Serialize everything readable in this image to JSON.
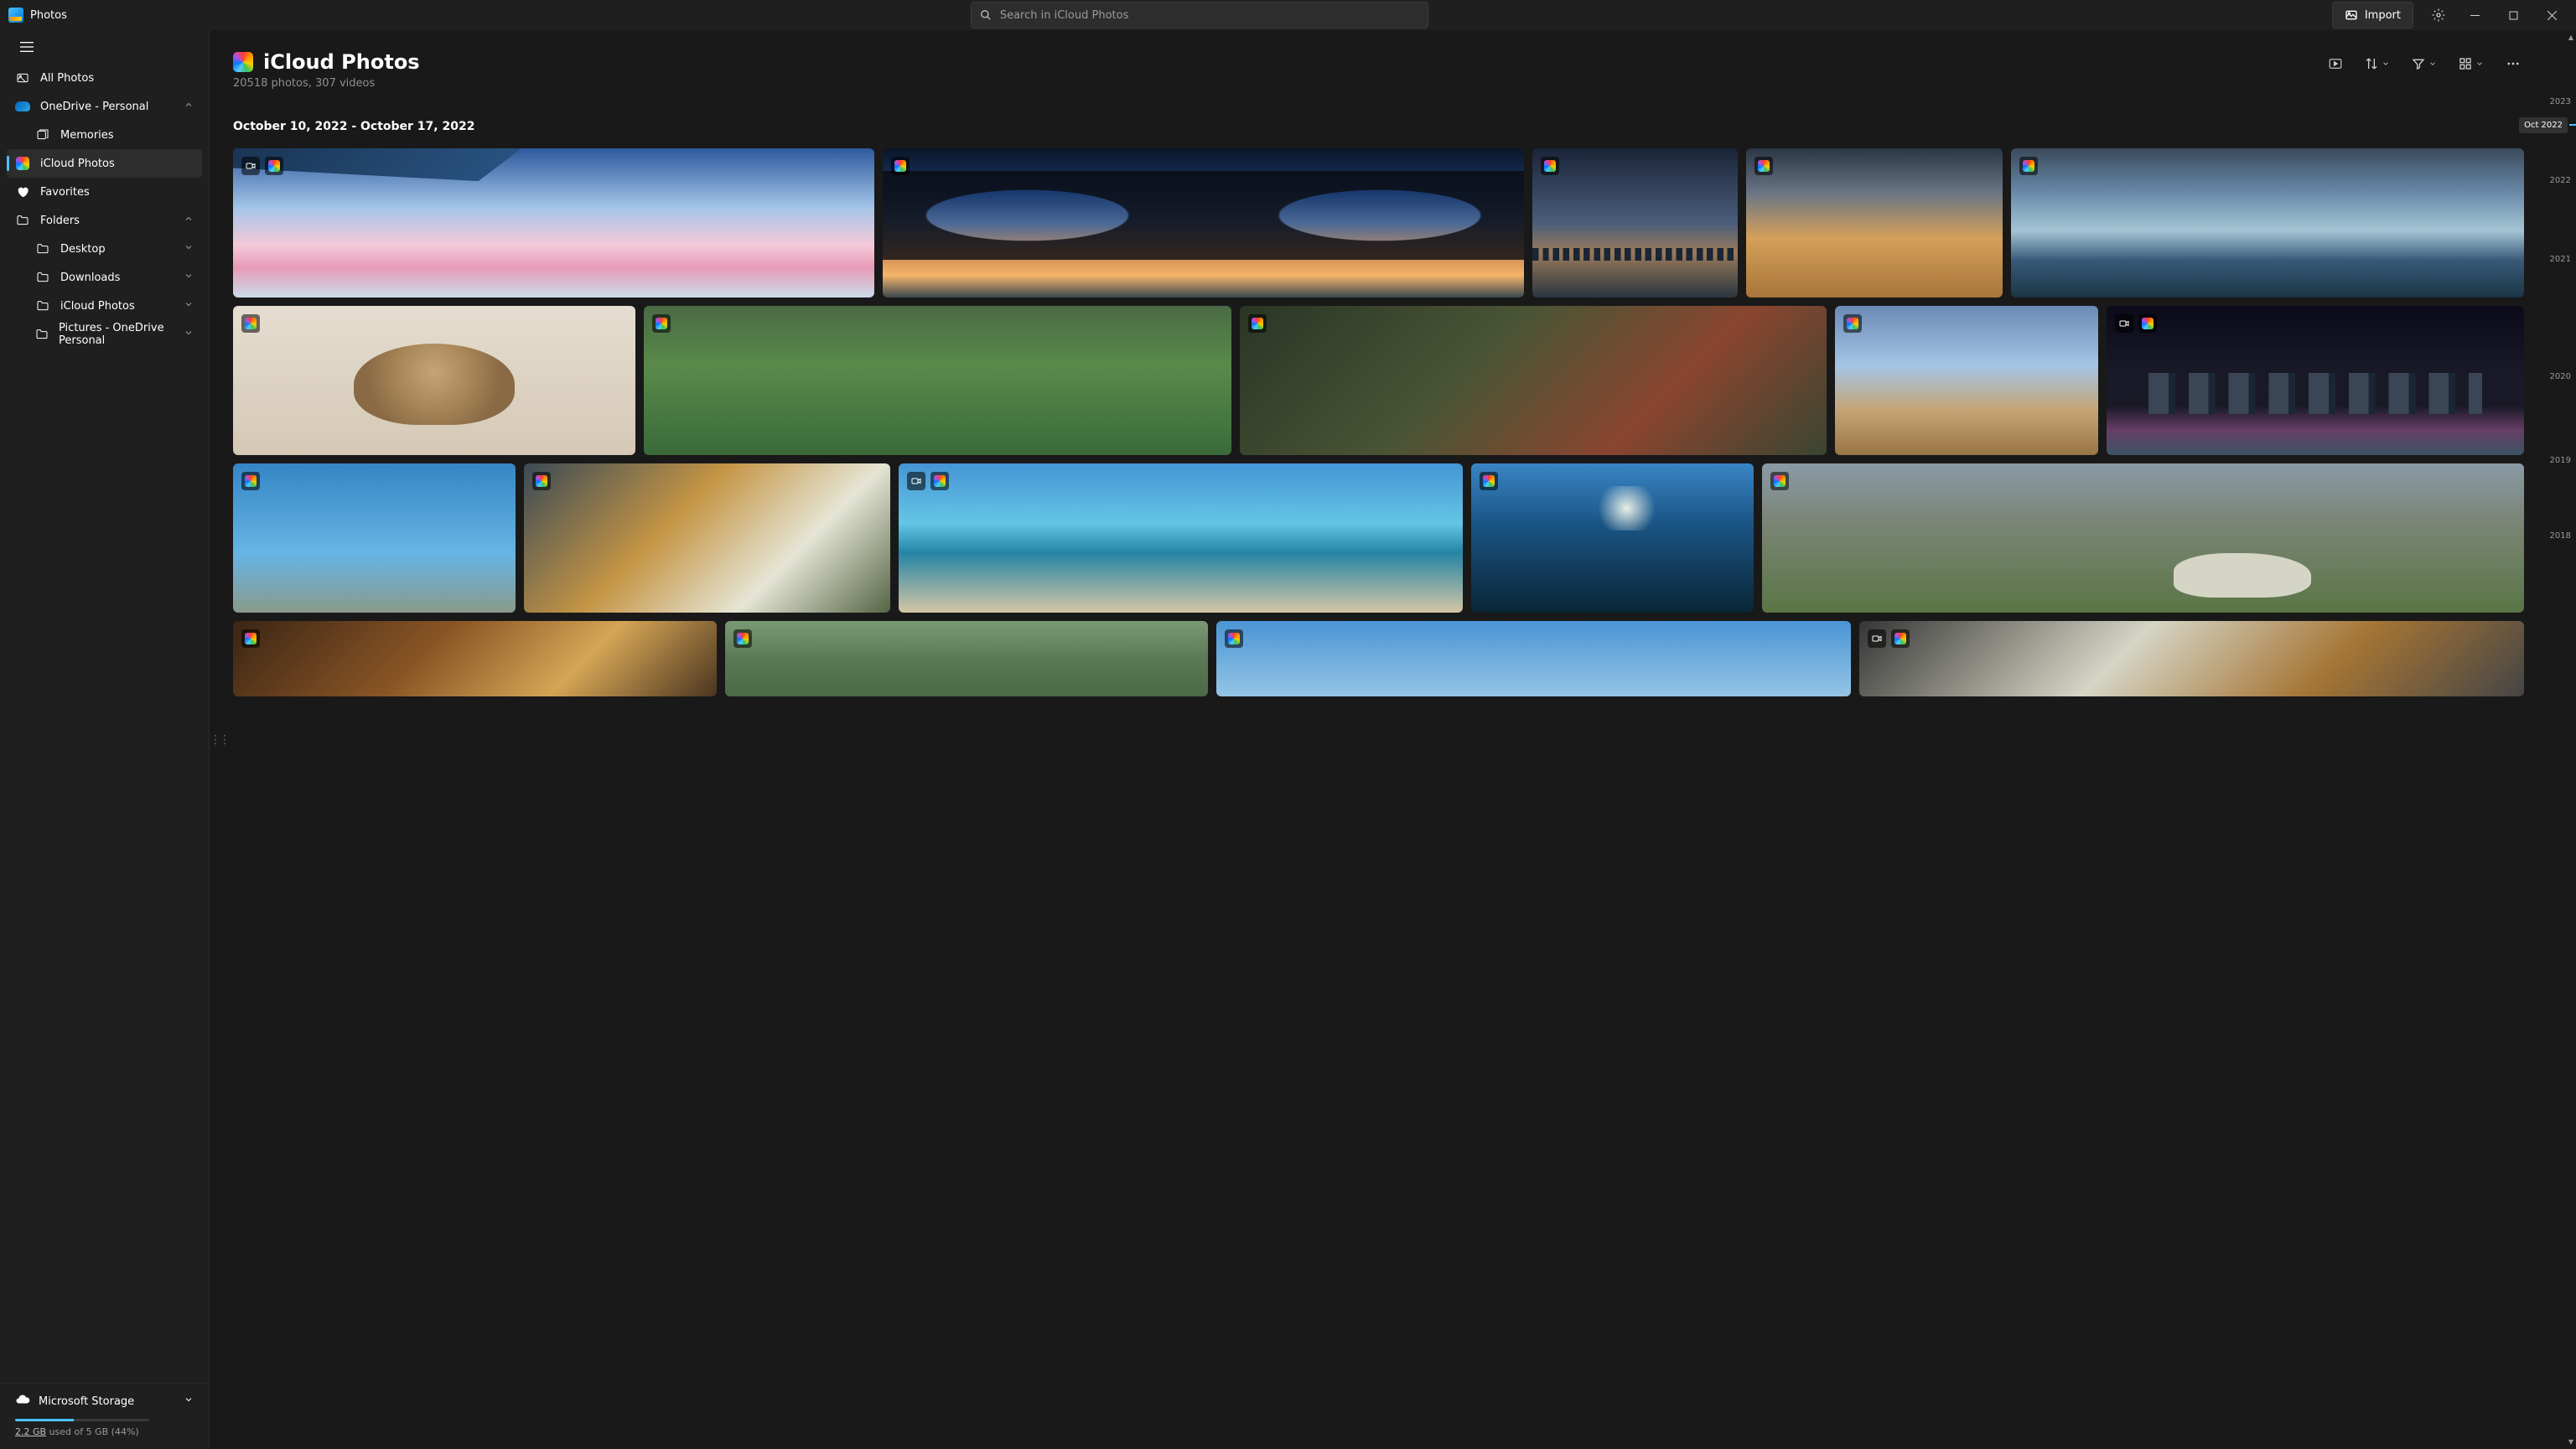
{
  "app": {
    "name": "Photos"
  },
  "search": {
    "placeholder": "Search in iCloud Photos"
  },
  "import": {
    "label": "Import"
  },
  "sidebar": {
    "all_photos": "All Photos",
    "onedrive": "OneDrive - Personal",
    "memories": "Memories",
    "icloud": "iCloud Photos",
    "favorites": "Favorites",
    "folders": "Folders",
    "desktop": "Desktop",
    "downloads": "Downloads",
    "icloud_folder": "iCloud Photos",
    "pictures": "Pictures - OneDrive Personal"
  },
  "storage": {
    "title": "Microsoft Storage",
    "used_amount": "2.2 GB",
    "rest": " used of 5 GB (44%)",
    "percent": 44
  },
  "page": {
    "title": "iCloud Photos",
    "subtitle": "20518 photos, 307 videos",
    "section_date": "October 10, 2022 - October 17, 2022"
  },
  "timeline": {
    "tooltip": "Oct 2022",
    "years": [
      "2023",
      "2022",
      "2021",
      "2020",
      "2019",
      "2018"
    ]
  }
}
